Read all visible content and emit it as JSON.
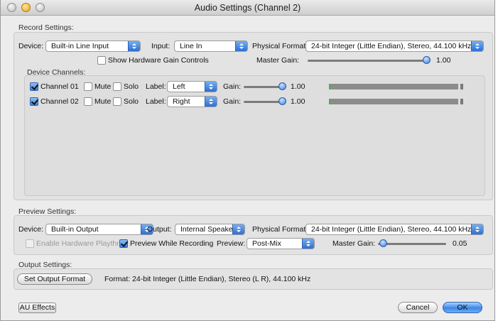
{
  "window": {
    "title": "Audio Settings (Channel 2)"
  },
  "record": {
    "section_label": "Record Settings:",
    "device_label": "Device:",
    "device_value": "Built-in Line Input",
    "input_label": "Input:",
    "input_value": "Line In",
    "format_label": "Physical Format:",
    "format_value": "24-bit Integer (Little Endian), Stereo, 44.100 kHz",
    "show_gain_label": "Show Hardware Gain Controls",
    "master_gain_label": "Master Gain:",
    "master_gain_value": "1.00",
    "device_channels_label": "Device Channels:",
    "channels": [
      {
        "name": "Channel 01",
        "checked": true,
        "mute_label": "Mute",
        "solo_label": "Solo",
        "label_label": "Label:",
        "label_value": "Left",
        "gain_label": "Gain:",
        "gain_value": "1.00"
      },
      {
        "name": "Channel 02",
        "checked": true,
        "mute_label": "Mute",
        "solo_label": "Solo",
        "label_label": "Label:",
        "label_value": "Right",
        "gain_label": "Gain:",
        "gain_value": "1.00"
      }
    ]
  },
  "preview": {
    "section_label": "Preview Settings:",
    "device_label": "Device:",
    "device_value": "Built-in Output",
    "output_label": "Output:",
    "output_value": "Internal Speakers",
    "format_label": "Physical Format:",
    "format_value": "24-bit Integer (Little Endian), Stereo, 44.100 kHz",
    "playthru_label": "Enable Hardware Playthru",
    "preview_recording_label": "Preview While Recording",
    "preview_label": "Preview:",
    "preview_value": "Post-Mix",
    "master_gain_label": "Master Gain:",
    "master_gain_value": "0.05"
  },
  "output": {
    "section_label": "Output Settings:",
    "set_format_button": "Set Output Format",
    "format_text": "Format:  24-bit Integer (Little Endian), Stereo (L R), 44.100 kHz"
  },
  "footer": {
    "au_effects_button": "AU Effects",
    "cancel_button": "Cancel",
    "ok_button": "OK"
  },
  "colors": {
    "accent": "#3d7fd6",
    "window_bg": "#ececec",
    "group_bg": "#e3e3e3",
    "meter_bar": "#8c8c8c",
    "meter_signal": "#3bbb3b"
  }
}
